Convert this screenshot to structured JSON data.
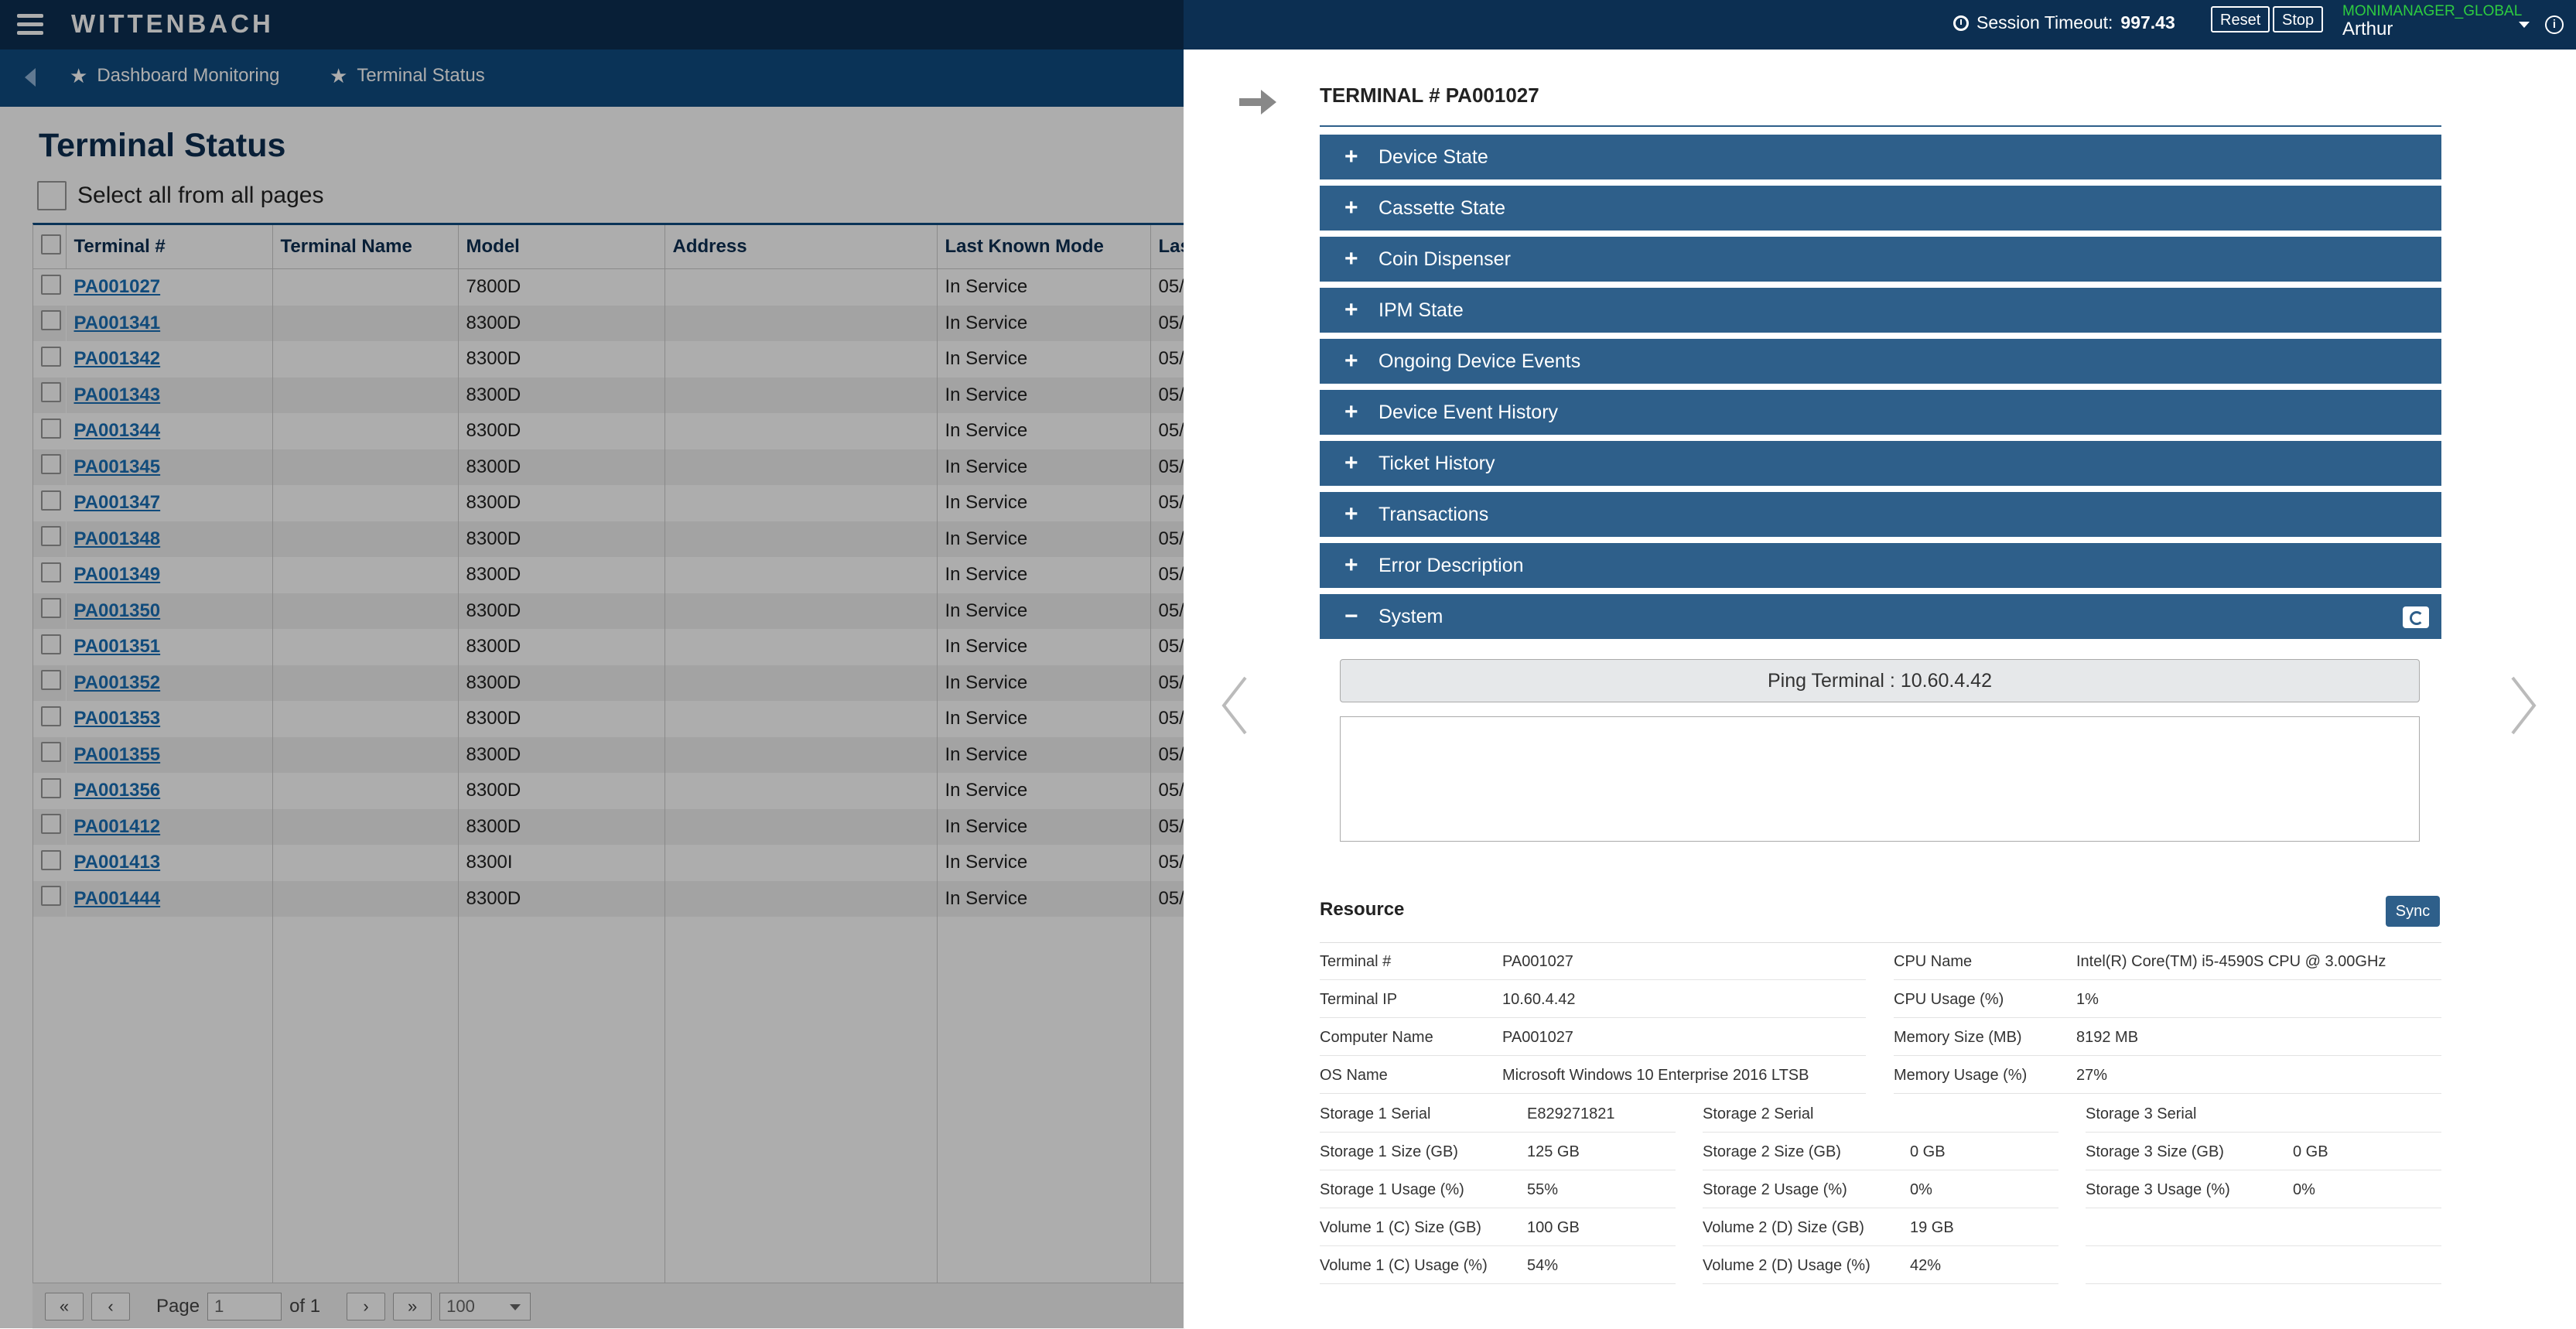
{
  "topbar": {
    "brand": "WITTENBACH",
    "session_timeout_label": "Session Timeout:",
    "session_timeout_value": "997.43",
    "reset_label": "Reset",
    "stop_label": "Stop",
    "user_org": "MONIMANAGER_GLOBAL",
    "user_name": "Arthur"
  },
  "breadcrumb": [
    "Dashboard Monitoring",
    "Terminal Status"
  ],
  "page": {
    "title": "Terminal Status",
    "select_all_label": "Select all from all pages"
  },
  "grid": {
    "columns": [
      "Terminal #",
      "Terminal Name",
      "Model",
      "Address",
      "Last Known Mode",
      "Las"
    ],
    "rows": [
      {
        "terminal": "PA001027",
        "name": "",
        "model": "7800D",
        "address": "",
        "mode": "In Service",
        "last": "05/"
      },
      {
        "terminal": "PA001341",
        "name": "",
        "model": "8300D",
        "address": "",
        "mode": "In Service",
        "last": "05/"
      },
      {
        "terminal": "PA001342",
        "name": "",
        "model": "8300D",
        "address": "",
        "mode": "In Service",
        "last": "05/"
      },
      {
        "terminal": "PA001343",
        "name": "",
        "model": "8300D",
        "address": "",
        "mode": "In Service",
        "last": "05/"
      },
      {
        "terminal": "PA001344",
        "name": "",
        "model": "8300D",
        "address": "",
        "mode": "In Service",
        "last": "05/"
      },
      {
        "terminal": "PA001345",
        "name": "",
        "model": "8300D",
        "address": "",
        "mode": "In Service",
        "last": "05/"
      },
      {
        "terminal": "PA001347",
        "name": "",
        "model": "8300D",
        "address": "",
        "mode": "In Service",
        "last": "05/"
      },
      {
        "terminal": "PA001348",
        "name": "",
        "model": "8300D",
        "address": "",
        "mode": "In Service",
        "last": "05/"
      },
      {
        "terminal": "PA001349",
        "name": "",
        "model": "8300D",
        "address": "",
        "mode": "In Service",
        "last": "05/"
      },
      {
        "terminal": "PA001350",
        "name": "",
        "model": "8300D",
        "address": "",
        "mode": "In Service",
        "last": "05/"
      },
      {
        "terminal": "PA001351",
        "name": "",
        "model": "8300D",
        "address": "",
        "mode": "In Service",
        "last": "05/"
      },
      {
        "terminal": "PA001352",
        "name": "",
        "model": "8300D",
        "address": "",
        "mode": "In Service",
        "last": "05/"
      },
      {
        "terminal": "PA001353",
        "name": "",
        "model": "8300D",
        "address": "",
        "mode": "In Service",
        "last": "05/"
      },
      {
        "terminal": "PA001355",
        "name": "",
        "model": "8300D",
        "address": "",
        "mode": "In Service",
        "last": "05/"
      },
      {
        "terminal": "PA001356",
        "name": "",
        "model": "8300D",
        "address": "",
        "mode": "In Service",
        "last": "05/"
      },
      {
        "terminal": "PA001412",
        "name": "",
        "model": "8300D",
        "address": "",
        "mode": "In Service",
        "last": "05/"
      },
      {
        "terminal": "PA001413",
        "name": "",
        "model": "8300I",
        "address": "",
        "mode": "In Service",
        "last": "05/"
      },
      {
        "terminal": "PA001444",
        "name": "",
        "model": "8300D",
        "address": "",
        "mode": "In Service",
        "last": "05/"
      }
    ]
  },
  "pager": {
    "first": "«",
    "prev": "‹",
    "page_label": "Page",
    "page_value": "1",
    "of_label": "of 1",
    "next": "›",
    "last": "»",
    "page_size": "100"
  },
  "panel": {
    "title": "TERMINAL # PA001027",
    "sections": [
      {
        "label": "Device State",
        "expanded": false
      },
      {
        "label": "Cassette State",
        "expanded": false
      },
      {
        "label": "Coin Dispenser",
        "expanded": false
      },
      {
        "label": "IPM State",
        "expanded": false
      },
      {
        "label": "Ongoing Device Events",
        "expanded": false
      },
      {
        "label": "Device Event History",
        "expanded": false
      },
      {
        "label": "Ticket History",
        "expanded": false
      },
      {
        "label": "Transactions",
        "expanded": false
      },
      {
        "label": "Error Description",
        "expanded": false
      },
      {
        "label": "System",
        "expanded": true
      }
    ],
    "ping_label": "Ping Terminal : 10.60.4.42",
    "resource_title": "Resource",
    "sync_label": "Sync",
    "resource_left": [
      {
        "k": "Terminal #",
        "v": "PA001027"
      },
      {
        "k": "Terminal IP",
        "v": "10.60.4.42"
      },
      {
        "k": "Computer Name",
        "v": "PA001027"
      },
      {
        "k": "OS Name",
        "v": "Microsoft Windows 10 Enterprise 2016 LTSB"
      }
    ],
    "resource_right": [
      {
        "k": "CPU Name",
        "v": "Intel(R) Core(TM) i5-4590S CPU @ 3.00GHz"
      },
      {
        "k": "CPU Usage (%)",
        "v": "1%"
      },
      {
        "k": "Memory Size (MB)",
        "v": "8192 MB"
      },
      {
        "k": "Memory Usage (%)",
        "v": "27%"
      }
    ],
    "storage": [
      [
        {
          "k": "Storage 1 Serial",
          "v": "E829271821"
        },
        {
          "k": "Storage 1 Size (GB)",
          "v": "125 GB"
        },
        {
          "k": "Storage 1 Usage (%)",
          "v": "55%"
        },
        {
          "k": "Volume 1 (C) Size (GB)",
          "v": "100 GB"
        },
        {
          "k": "Volume 1 (C) Usage (%)",
          "v": "54%"
        }
      ],
      [
        {
          "k": "Storage 2 Serial",
          "v": ""
        },
        {
          "k": "Storage 2 Size (GB)",
          "v": "0 GB"
        },
        {
          "k": "Storage 2 Usage (%)",
          "v": "0%"
        },
        {
          "k": "Volume 2 (D) Size (GB)",
          "v": "19 GB"
        },
        {
          "k": "Volume 2 (D) Usage (%)",
          "v": "42%"
        }
      ],
      [
        {
          "k": "Storage 3 Serial",
          "v": ""
        },
        {
          "k": "Storage 3 Size (GB)",
          "v": "0 GB"
        },
        {
          "k": "Storage 3 Usage (%)",
          "v": "0%"
        },
        {
          "k": "",
          "v": ""
        },
        {
          "k": "",
          "v": ""
        }
      ]
    ]
  }
}
